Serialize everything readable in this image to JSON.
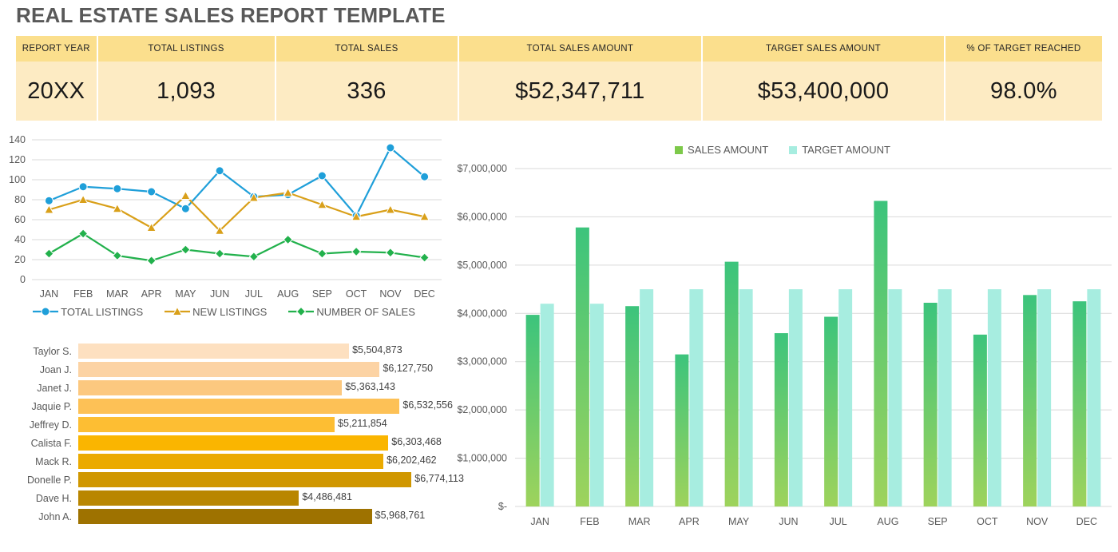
{
  "title": "REAL ESTATE SALES REPORT TEMPLATE",
  "summary": {
    "headers": [
      "REPORT YEAR",
      "TOTAL LISTINGS",
      "TOTAL SALES",
      "TOTAL SALES AMOUNT",
      "TARGET SALES AMOUNT",
      "% OF TARGET REACHED"
    ],
    "values": [
      "20XX",
      "1,093",
      "336",
      "$52,347,711",
      "$53,400,000",
      "98.0%"
    ],
    "header_bg": "#FBDF8D",
    "value_bg": "#FDEBC3"
  },
  "chart_data": [
    {
      "type": "line",
      "name": "listings-and-sales-trend",
      "categories": [
        "JAN",
        "FEB",
        "MAR",
        "APR",
        "MAY",
        "JUN",
        "JUL",
        "AUG",
        "SEP",
        "OCT",
        "NOV",
        "DEC"
      ],
      "series": [
        {
          "name": "TOTAL LISTINGS",
          "color": "#1F9FD9",
          "marker": "circle",
          "values": [
            79,
            93,
            91,
            88,
            71,
            109,
            83,
            85,
            104,
            64,
            132,
            103
          ]
        },
        {
          "name": "NEW LISTINGS",
          "color": "#D9A01A",
          "marker": "triangle",
          "values": [
            70,
            80,
            71,
            52,
            84,
            49,
            82,
            87,
            75,
            63,
            70,
            63
          ]
        },
        {
          "name": "NUMBER OF SALES",
          "color": "#22B14C",
          "marker": "diamond",
          "values": [
            26,
            46,
            24,
            19,
            30,
            26,
            23,
            40,
            26,
            28,
            27,
            22
          ]
        }
      ],
      "ylim": [
        0,
        140
      ],
      "yticks": [
        0,
        20,
        40,
        60,
        80,
        100,
        120,
        140
      ],
      "xlabel": "",
      "ylabel": "",
      "grid": true,
      "legend_position": "bottom"
    },
    {
      "type": "bar",
      "orientation": "horizontal",
      "name": "sales-by-agent",
      "categories": [
        "Taylor S.",
        "Joan J.",
        "Janet J.",
        "Jaquie P.",
        "Jeffrey D.",
        "Calista F.",
        "Mack R.",
        "Donelle P.",
        "Dave H.",
        "John A."
      ],
      "values": [
        5504873,
        6127750,
        5363143,
        6532556,
        5211854,
        6303468,
        6202462,
        6774113,
        4486481,
        5968761
      ],
      "value_labels": [
        "$5,504,873",
        "$6,127,750",
        "$5,363,143",
        "$6,532,556",
        "$5,211,854",
        "$6,303,468",
        "$6,202,462",
        "$6,774,113",
        "$4,486,481",
        "$5,968,761"
      ],
      "bar_colors": [
        "#FDE0C0",
        "#FCD3A4",
        "#FCC87F",
        "#FDC156",
        "#FDBE33",
        "#FAB500",
        "#EBAA00",
        "#D09700",
        "#B98600",
        "#9E7200"
      ],
      "xlim": [
        0,
        7500000
      ],
      "grid": true,
      "legend_position": "none"
    },
    {
      "type": "bar",
      "orientation": "vertical",
      "name": "sales-vs-target-by-month",
      "categories": [
        "JAN",
        "FEB",
        "MAR",
        "APR",
        "MAY",
        "JUN",
        "JUL",
        "AUG",
        "SEP",
        "OCT",
        "NOV",
        "DEC"
      ],
      "series": [
        {
          "name": "SALES AMOUNT",
          "color": "#3CC47C",
          "color_bottom": "#9ED35C",
          "values": [
            3970000,
            5780000,
            4150000,
            3150000,
            5070000,
            3590000,
            3930000,
            6330000,
            4220000,
            3560000,
            4380000,
            4250000
          ]
        },
        {
          "name": "TARGET AMOUNT",
          "color": "#A7EDE0",
          "color_bottom": "#A7EDE0",
          "values": [
            4200000,
            4200000,
            4500000,
            4500000,
            4500000,
            4500000,
            4500000,
            4500000,
            4500000,
            4500000,
            4500000,
            4500000
          ]
        }
      ],
      "ylim": [
        0,
        7000000
      ],
      "yticks": [
        0,
        1000000,
        2000000,
        3000000,
        4000000,
        5000000,
        6000000,
        7000000
      ],
      "ytick_labels": [
        "$-",
        "$1,000,000",
        "$2,000,000",
        "$3,000,000",
        "$4,000,000",
        "$5,000,000",
        "$6,000,000",
        "$7,000,000"
      ],
      "xlabel": "",
      "ylabel": "",
      "grid": true,
      "legend_position": "top"
    }
  ]
}
